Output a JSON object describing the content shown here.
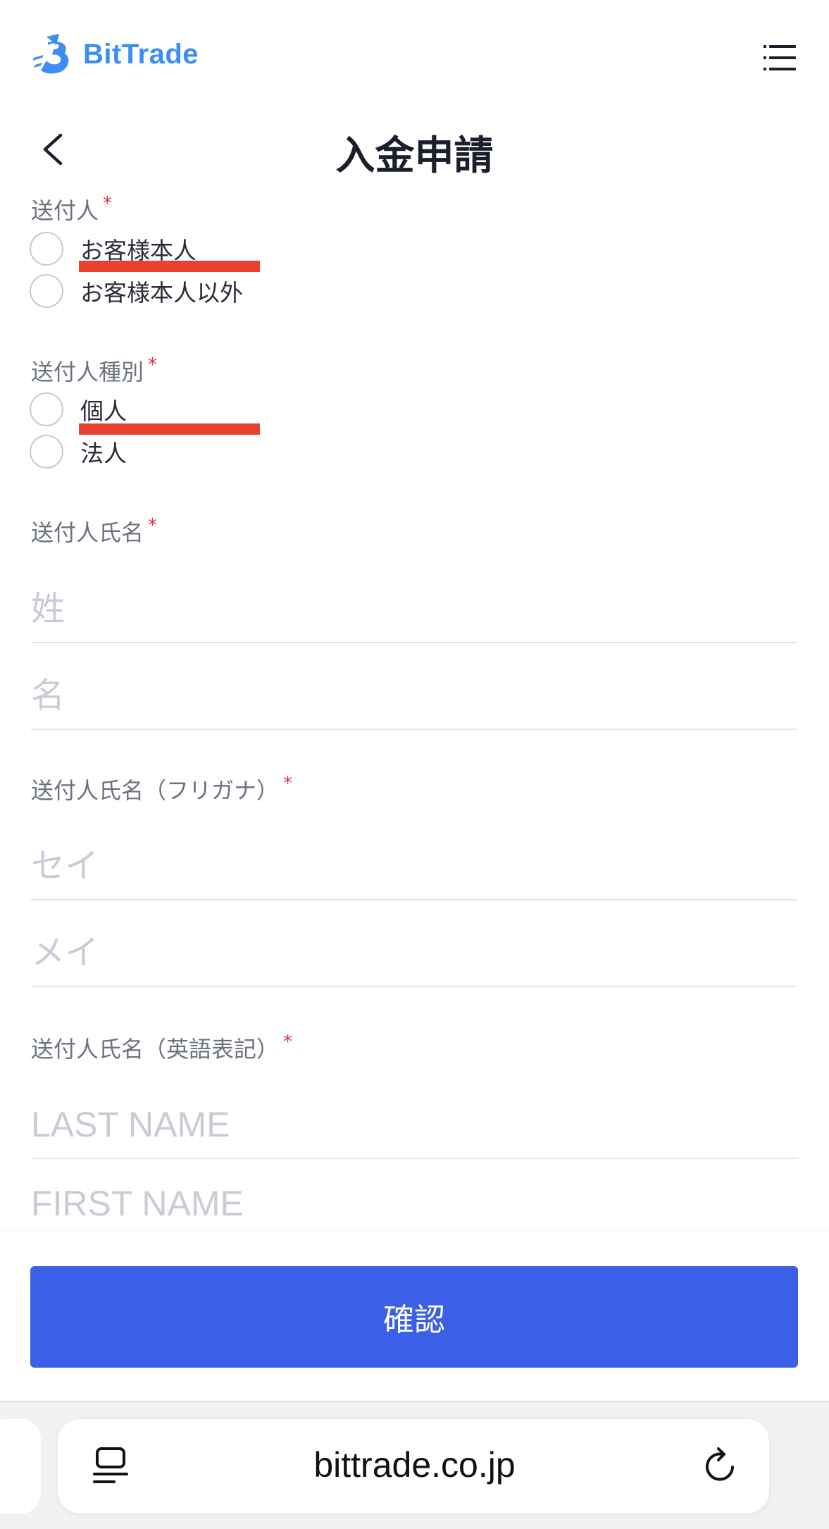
{
  "header": {
    "brand": "BitTrade",
    "title": "入金申請"
  },
  "form": {
    "sender": {
      "label": "送付人",
      "required": "*",
      "options": [
        "お客様本人",
        "お客様本人以外"
      ]
    },
    "sender_type": {
      "label": "送付人種別",
      "required": "*",
      "options": [
        "個人",
        "法人"
      ]
    },
    "sender_name": {
      "label": "送付人氏名",
      "required": "*",
      "last_placeholder": "姓",
      "first_placeholder": "名"
    },
    "sender_kana": {
      "label": "送付人氏名（フリガナ）",
      "required": "*",
      "last_placeholder": "セイ",
      "first_placeholder": "メイ"
    },
    "sender_english": {
      "label": "送付人氏名（英語表記）",
      "required": "*",
      "last_placeholder": "LAST NAME",
      "first_placeholder": "FIRST NAME"
    }
  },
  "footer": {
    "confirm_label": "確認"
  },
  "browser": {
    "url": "bittrade.co.jp"
  },
  "colors": {
    "brand": "#3d8ef2",
    "primary_button": "#3b5fe6",
    "required_mark": "#d6394a",
    "highlight": "#e94130"
  }
}
